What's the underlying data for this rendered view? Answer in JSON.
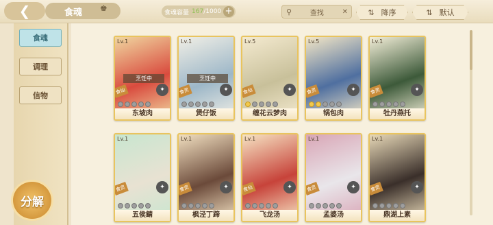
{
  "header": {
    "back_symbol": "❮",
    "title": "食魂",
    "capacity_label": "食魂容量",
    "capacity_used": "167",
    "capacity_total": "/1000",
    "plus_symbol": "+",
    "search_label": "查找",
    "sort_order_label": "降序",
    "sort_mode_label": "默认"
  },
  "sidebar": {
    "tabs": [
      "食魂",
      "调理",
      "信物"
    ],
    "decompose_label": "分解"
  },
  "cards": [
    {
      "level": "Lv.1",
      "name": "东坡肉",
      "grade": "食仙",
      "status": "烹饪中",
      "bg1": "#d94b3e",
      "bg2": "#f0d6a0",
      "pips": 5,
      "stars": 0
    },
    {
      "level": "Lv.1",
      "name": "煲仔饭",
      "grade": "食灵",
      "status": "烹饪中",
      "bg1": "#9db7c8",
      "bg2": "#f1efe6",
      "pips": 5,
      "stars": 0
    },
    {
      "level": "Lv.5",
      "name": "缠花云梦肉",
      "grade": "食仙",
      "status": "",
      "bg1": "#c8c09a",
      "bg2": "#f4ead0",
      "pips": 5,
      "stars": 1
    },
    {
      "level": "Lv.5",
      "name": "锅包肉",
      "grade": "食灵",
      "status": "",
      "bg1": "#4f6fa0",
      "bg2": "#f4e7c6",
      "pips": 5,
      "stars": 2
    },
    {
      "level": "Lv.1",
      "name": "牡丹燕托",
      "grade": "食灵",
      "status": "",
      "bg1": "#3d5a3a",
      "bg2": "#f3eed8",
      "pips": 5,
      "stars": 0
    },
    {
      "level": "Lv.1",
      "name": "五侯鲭",
      "grade": "食灵",
      "status": "",
      "bg1": "#e8e2d2",
      "bg2": "#c8e6d0",
      "pips": 5,
      "stars": 0
    },
    {
      "level": "Lv.1",
      "name": "枫泾丁蹄",
      "grade": "食灵",
      "status": "",
      "bg1": "#6b4a3a",
      "bg2": "#f1dfc0",
      "pips": 5,
      "stars": 0
    },
    {
      "level": "Lv.1",
      "name": "飞龙汤",
      "grade": "食仙",
      "status": "",
      "bg1": "#c7433a",
      "bg2": "#f6e4c4",
      "pips": 5,
      "stars": 0
    },
    {
      "level": "Lv.1",
      "name": "孟婆汤",
      "grade": "食灵",
      "status": "",
      "bg1": "#e9e6ea",
      "bg2": "#d9a6b6",
      "pips": 5,
      "stars": 0
    },
    {
      "level": "Lv.1",
      "name": "鼎湖上素",
      "grade": "食灵",
      "status": "",
      "bg1": "#3a2f2a",
      "bg2": "#e8d9b8",
      "pips": 5,
      "stars": 0
    }
  ]
}
